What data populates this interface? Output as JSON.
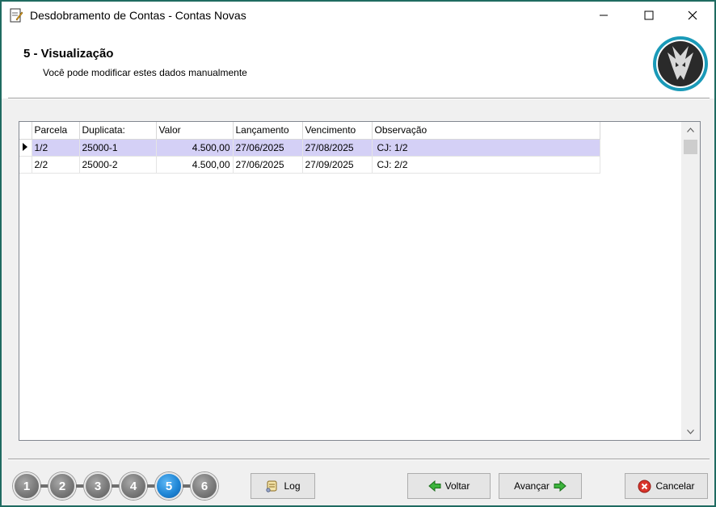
{
  "window": {
    "title": "Desdobramento de Contas - Contas Novas",
    "minimize": "—",
    "maximize": "☐",
    "close": "✕"
  },
  "header": {
    "step_title": "5 - Visualização",
    "subtitle": "Você pode modificar estes dados manualmente"
  },
  "grid": {
    "columns": [
      "Parcela",
      "Duplicata:",
      "Valor",
      "Lançamento",
      "Vencimento",
      "Observação"
    ],
    "rows": [
      {
        "parcela": "1/2",
        "duplicata": "25000-1",
        "valor": "4.500,00",
        "lancamento": "27/06/2025",
        "vencimento": "27/08/2025",
        "observacao": "CJ: 1/2"
      },
      {
        "parcela": "2/2",
        "duplicata": "25000-2",
        "valor": "4.500,00",
        "lancamento": "27/06/2025",
        "vencimento": "27/09/2025",
        "observacao": "CJ: 2/2"
      }
    ],
    "selected_row": 0,
    "scroll_up": "▲",
    "scroll_down": "▼"
  },
  "steps": [
    "1",
    "2",
    "3",
    "4",
    "5",
    "6"
  ],
  "active_step": "5",
  "buttons": {
    "log": "Log",
    "back": "Voltar",
    "next": "Avançar",
    "cancel": "Cancelar"
  },
  "colors": {
    "selection": "#d4d0f6",
    "active_step": "#1f86d6",
    "window_border": "#1f6b61"
  }
}
